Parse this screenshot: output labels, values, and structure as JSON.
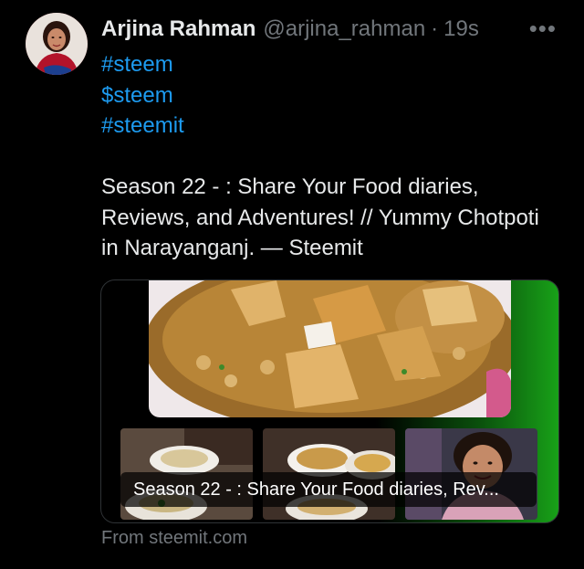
{
  "tweet": {
    "author_name": "Arjina Rahman",
    "handle": "@arjina_rahman",
    "separator": "·",
    "time": "19s",
    "more_label": "•••",
    "tags": [
      "#steem",
      "$steem",
      "#steemit"
    ],
    "text": "Season 22 - : Share Your Food diaries, Reviews, and Adventures! // Yummy Chotpoti in Narayanganj. — Steemit"
  },
  "card": {
    "caption": "Season 22 - : Share Your Food diaries, Rev...",
    "source": "From steemit.com"
  },
  "colors": {
    "background": "#000000",
    "text": "#e7e9ea",
    "muted": "#71767b",
    "link": "#1d9bf0",
    "card_gradient_end": "#18a118"
  }
}
